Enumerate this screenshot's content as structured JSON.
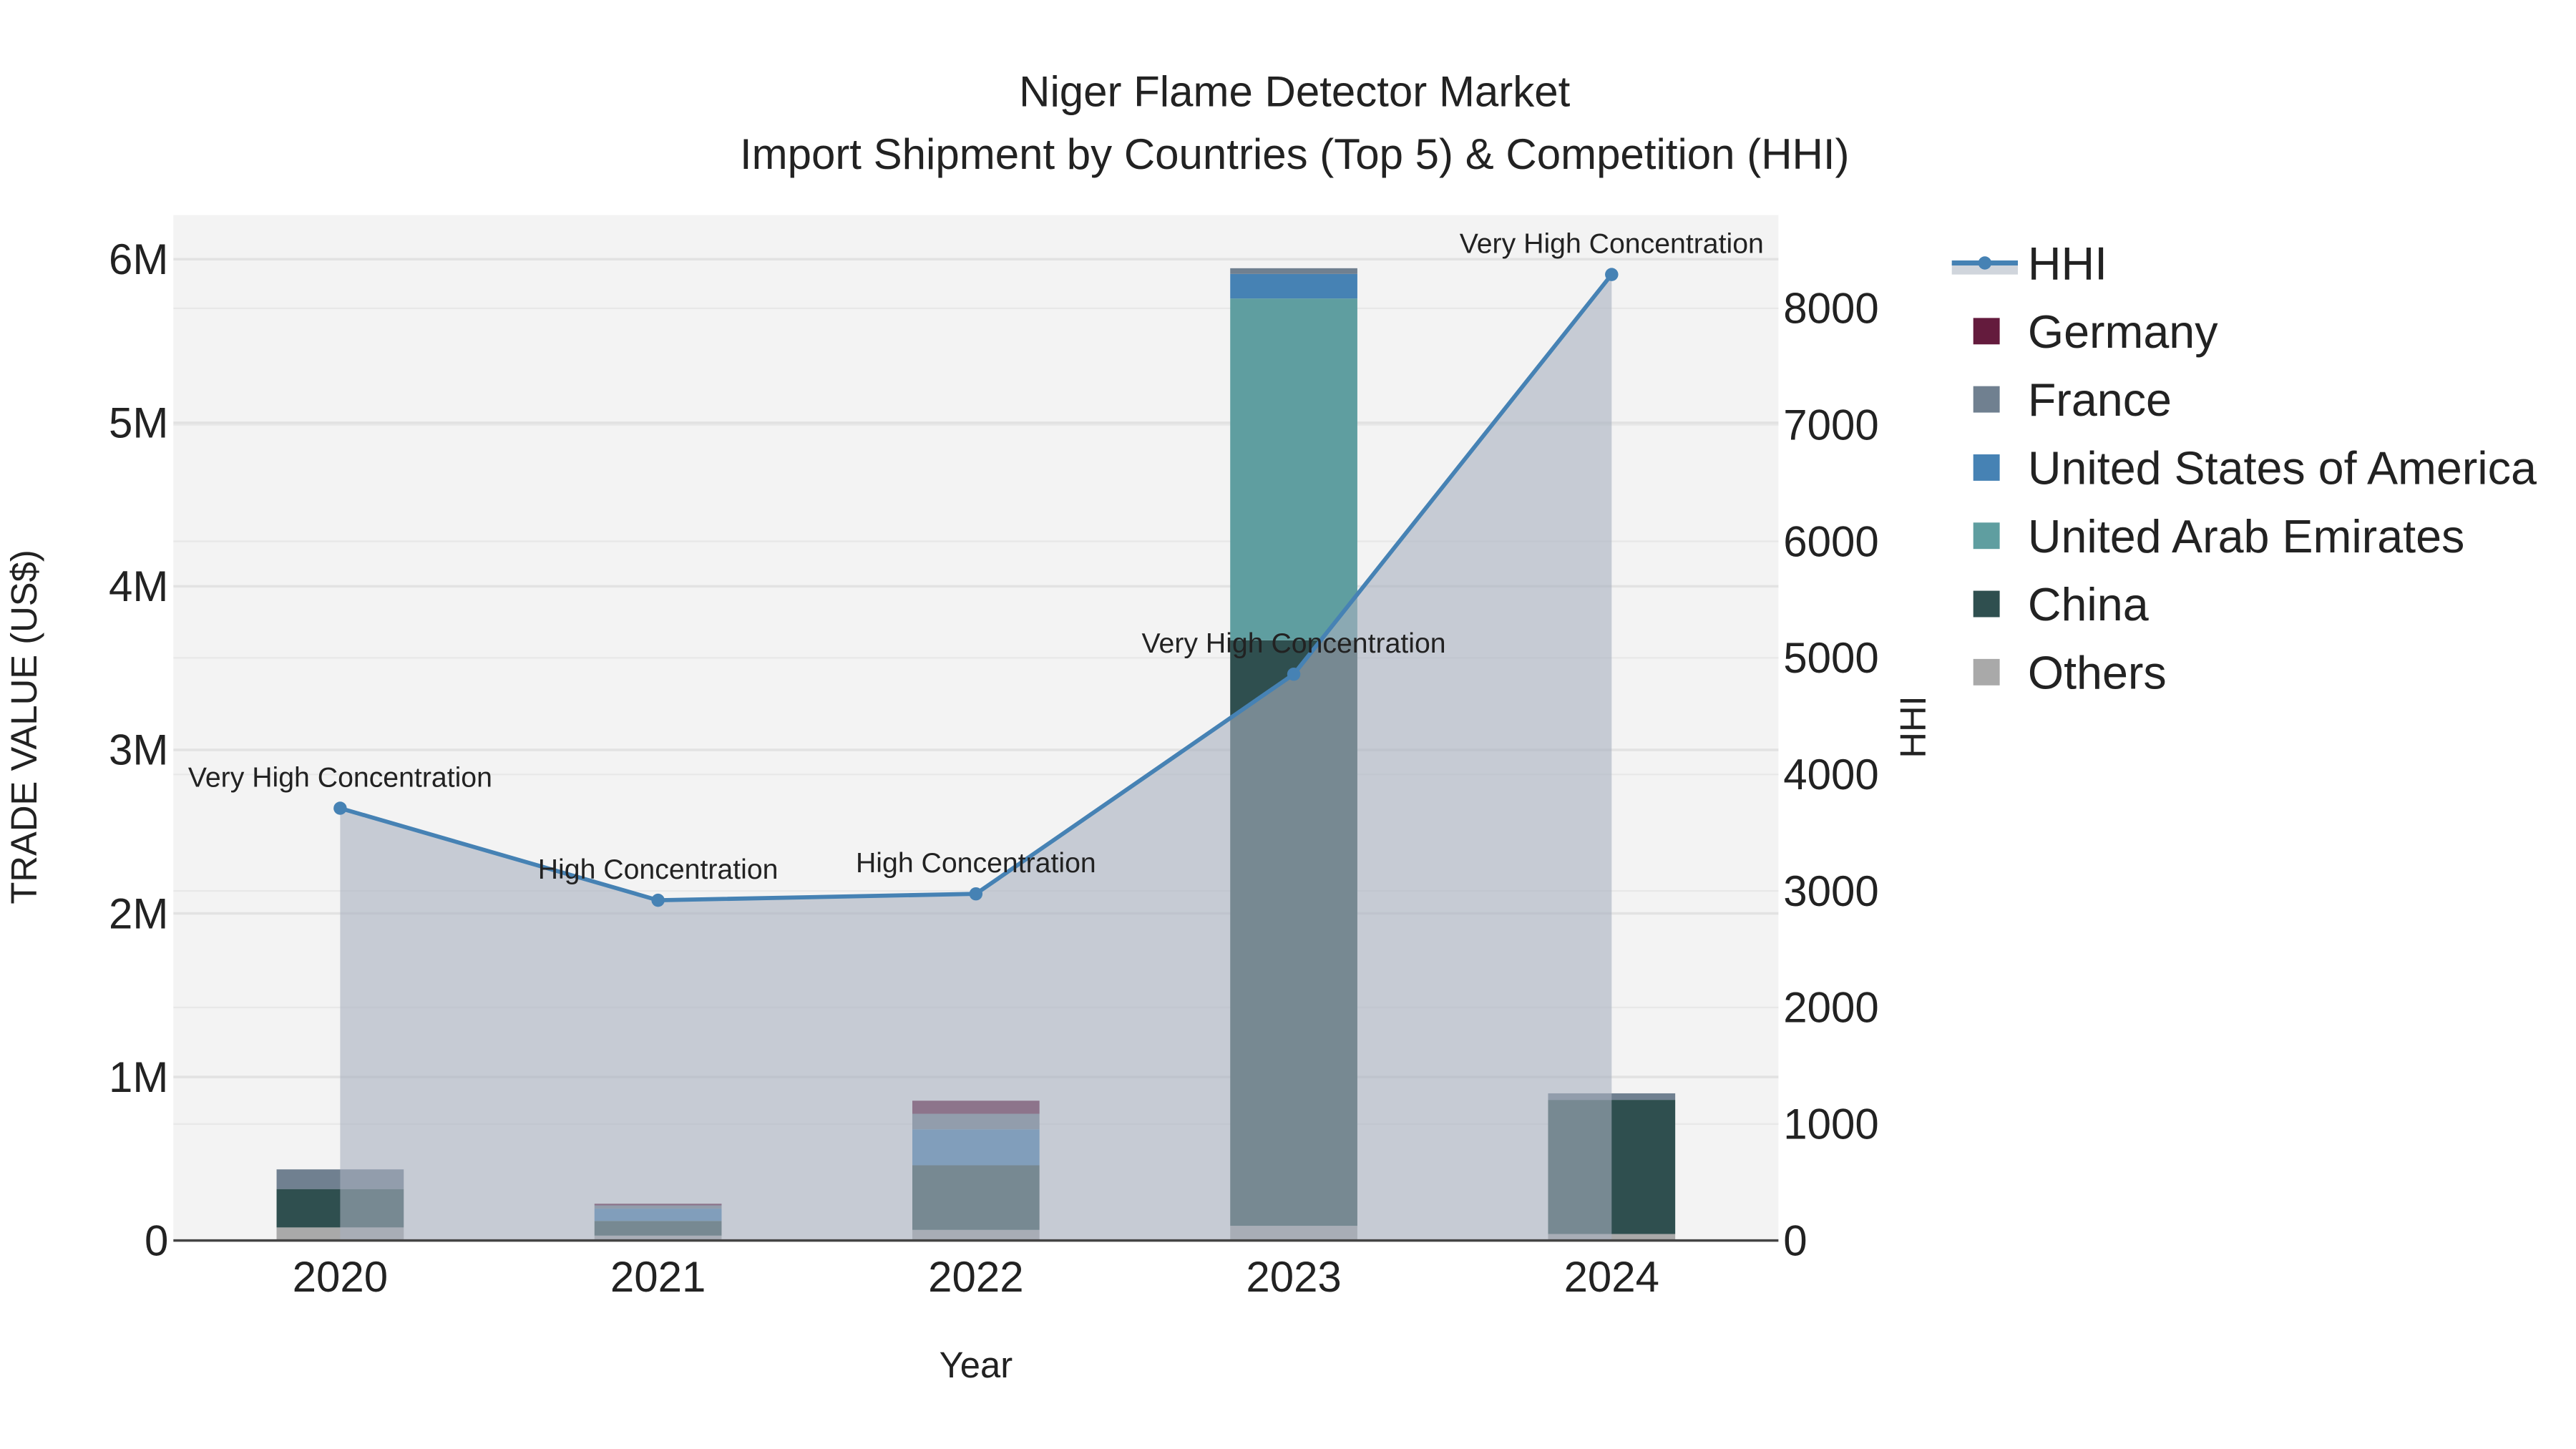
{
  "chart_data": {
    "type": "bar",
    "title": "Niger Flame Detector Market",
    "subtitle": "Import Shipment by Countries (Top 5) & Competition (HHI)",
    "xlabel": "Year",
    "ylabel": "TRADE VALUE (US$)",
    "y2label": "HHI",
    "categories": [
      "2020",
      "2021",
      "2022",
      "2023",
      "2024"
    ],
    "ylim": [
      0,
      6270000
    ],
    "y2lim": [
      0,
      8800
    ],
    "yticks": [
      {
        "v": 0,
        "label": "0"
      },
      {
        "v": 1000000,
        "label": "1M"
      },
      {
        "v": 2000000,
        "label": "2M"
      },
      {
        "v": 3000000,
        "label": "3M"
      },
      {
        "v": 4000000,
        "label": "4M"
      },
      {
        "v": 5000000,
        "label": "5M"
      },
      {
        "v": 6000000,
        "label": "6M"
      }
    ],
    "y2ticks": [
      {
        "v": 0,
        "label": "0"
      },
      {
        "v": 1000,
        "label": "1000"
      },
      {
        "v": 2000,
        "label": "2000"
      },
      {
        "v": 3000,
        "label": "3000"
      },
      {
        "v": 4000,
        "label": "4000"
      },
      {
        "v": 5000,
        "label": "5000"
      },
      {
        "v": 6000,
        "label": "6000"
      },
      {
        "v": 7000,
        "label": "7000"
      },
      {
        "v": 8000,
        "label": "8000"
      }
    ],
    "grid": true,
    "legend_position": "right",
    "series": [
      {
        "name": "Others",
        "color": "#a9a9a9",
        "values": [
          80000,
          30000,
          65000,
          90000,
          40000
        ]
      },
      {
        "name": "China",
        "color": "#2f4f4f",
        "values": [
          235000,
          90000,
          395000,
          3580000,
          820000
        ]
      },
      {
        "name": "United Arab Emirates",
        "color": "#5f9ea0",
        "values": [
          0,
          0,
          0,
          2090000,
          0
        ]
      },
      {
        "name": "United States of America",
        "color": "#4682b4",
        "values": [
          0,
          75000,
          220000,
          150000,
          0
        ]
      },
      {
        "name": "France",
        "color": "#708090",
        "values": [
          120000,
          20000,
          95000,
          35000,
          40000
        ]
      },
      {
        "name": "Germany",
        "color": "#641b3d",
        "values": [
          0,
          10000,
          80000,
          0,
          0
        ]
      }
    ],
    "hhi": {
      "name": "HHI",
      "color": "#4682b4",
      "values": [
        3710,
        2920,
        2975,
        4860,
        8290
      ],
      "labels": [
        "Very High Concentration",
        "High Concentration",
        "High Concentration",
        "Very High Concentration",
        "Very High Concentration"
      ]
    },
    "legend": [
      "HHI",
      "Germany",
      "France",
      "United States of America",
      "United Arab Emirates",
      "China",
      "Others"
    ]
  }
}
